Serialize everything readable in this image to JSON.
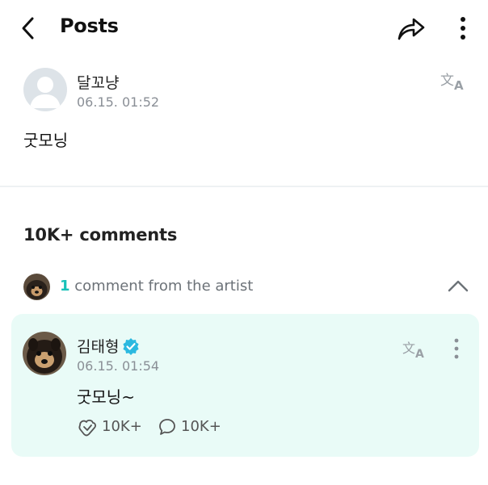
{
  "header": {
    "title": "Posts"
  },
  "post": {
    "author": "달꼬냥",
    "date": "06.15. 01:52",
    "body": "굿모닝"
  },
  "comments": {
    "count_label": "10K+ comments",
    "artist_count": "1",
    "artist_label": " comment from the artist"
  },
  "artist_comment": {
    "name": "김태형",
    "date": "06.15. 01:54",
    "text": "굿모닝~",
    "likes": "10K+",
    "replies": "10K+"
  },
  "colors": {
    "accent": "#17c1b8",
    "card_bg": "#e9fbf7",
    "verified": "#2bb9e0"
  },
  "icons": [
    "back-arrow-icon",
    "share-icon",
    "more-vertical-icon",
    "translate-icon",
    "chevron-up-icon",
    "verified-badge-icon",
    "like-icon",
    "comment-icon"
  ]
}
